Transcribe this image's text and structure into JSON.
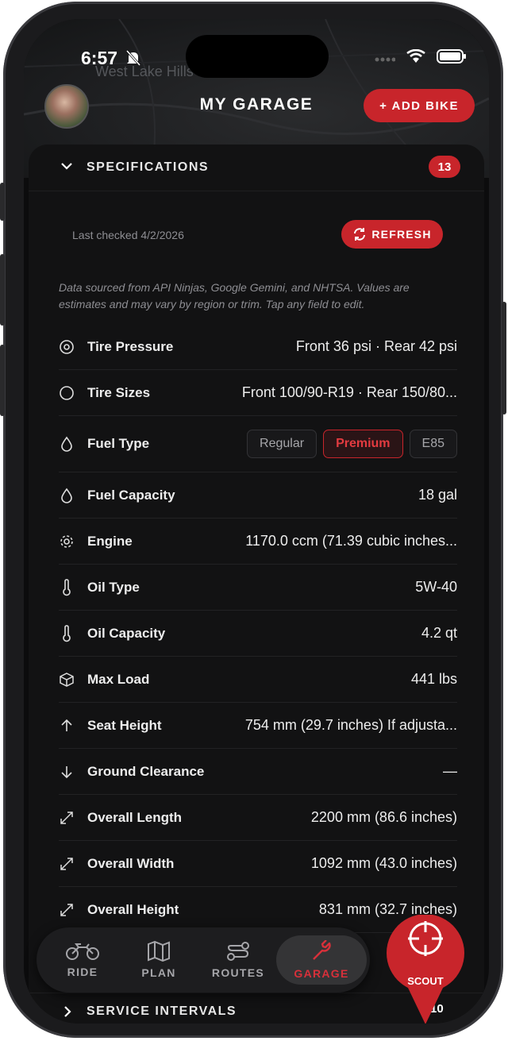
{
  "status": {
    "time": "6:57"
  },
  "map": {
    "label": "West Lake Hills"
  },
  "header": {
    "title": "MY GARAGE",
    "add_bike_label": "+ ADD BIKE"
  },
  "specifications": {
    "label": "SPECIFICATIONS",
    "count": "13",
    "last_checked": "Last checked 4/2/2026",
    "refresh_label": "REFRESH",
    "note": "Data sourced from API Ninjas, Google Gemini, and NHTSA. Values are estimates and may vary by region or trim. Tap any field to edit.",
    "rows": [
      {
        "icon": "target-icon",
        "label": "Tire Pressure",
        "value": "Front 36 psi · Rear 42 psi"
      },
      {
        "icon": "circle-icon",
        "label": "Tire Sizes",
        "value": "Front 100/90-R19 · Rear 150/80..."
      },
      {
        "icon": "drop-icon",
        "label": "Fuel Type",
        "options": [
          "Regular",
          "Premium",
          "E85"
        ],
        "selected": "Premium"
      },
      {
        "icon": "drop-icon",
        "label": "Fuel Capacity",
        "value": "18 gal"
      },
      {
        "icon": "gear-icon",
        "label": "Engine",
        "value": "1170.0 ccm (71.39 cubic inches..."
      },
      {
        "icon": "thermometer-icon",
        "label": "Oil Type",
        "value": "5W-40"
      },
      {
        "icon": "thermometer-icon",
        "label": "Oil Capacity",
        "value": "4.2 qt"
      },
      {
        "icon": "box-icon",
        "label": "Max Load",
        "value": "441 lbs"
      },
      {
        "icon": "arrow-up-icon",
        "label": "Seat Height",
        "value": "754 mm (29.7 inches) If adjusta..."
      },
      {
        "icon": "arrow-down-icon",
        "label": "Ground Clearance",
        "value": "—"
      },
      {
        "icon": "expand-icon",
        "label": "Overall Length",
        "value": "2200 mm (86.6 inches)"
      },
      {
        "icon": "expand-icon",
        "label": "Overall Width",
        "value": "1092 mm (43.0 inches)"
      },
      {
        "icon": "expand-icon",
        "label": "Overall Height",
        "value": "831 mm (32.7 inches)"
      }
    ]
  },
  "tabs": [
    {
      "icon": "motorcycle-icon",
      "label": "RIDE"
    },
    {
      "icon": "map-icon",
      "label": "PLAN"
    },
    {
      "icon": "route-icon",
      "label": "ROUTES"
    },
    {
      "icon": "wrench-icon",
      "label": "GARAGE",
      "active": true
    }
  ],
  "scout": {
    "label": "SCOUT"
  },
  "service_intervals": {
    "label": "SERVICE INTERVALS",
    "count": "10"
  },
  "colors": {
    "accent": "#c8252b",
    "background": "#121213",
    "text": "#ededed",
    "muted": "#8e8e93"
  }
}
